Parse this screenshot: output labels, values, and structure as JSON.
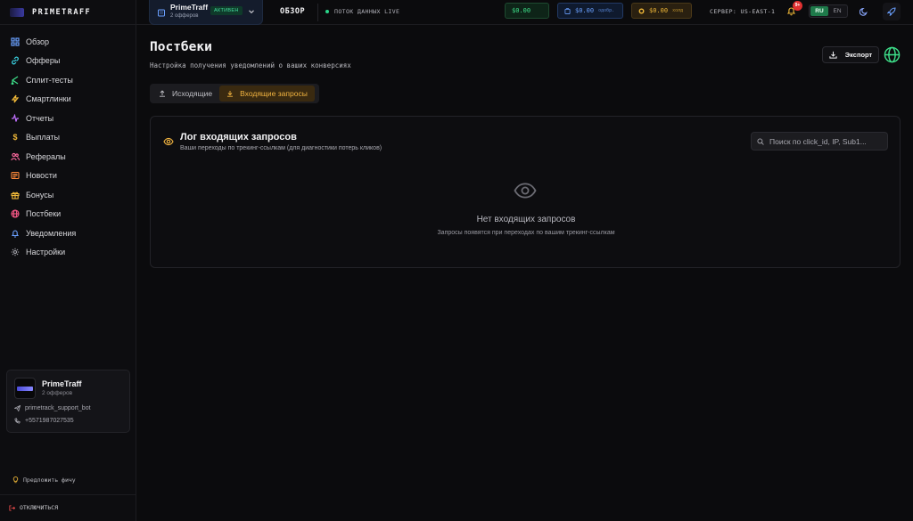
{
  "brand": {
    "name": "PRIMETRAFF"
  },
  "sidebar": {
    "items": [
      {
        "label": "Обзор",
        "icon": "grid-icon",
        "color": "#6aa0ff"
      },
      {
        "label": "Офферы",
        "icon": "link-icon",
        "color": "#3ad0e0"
      },
      {
        "label": "Сплит-тесты",
        "icon": "split-icon",
        "color": "#3ee08a"
      },
      {
        "label": "Смартлинки",
        "icon": "bolt-icon",
        "color": "#f0b838"
      },
      {
        "label": "Отчеты",
        "icon": "activity-icon",
        "color": "#c070ff"
      },
      {
        "label": "Выплаты",
        "icon": "dollar-icon",
        "color": "#f0b838"
      },
      {
        "label": "Рефералы",
        "icon": "users-icon",
        "color": "#ff6aa0"
      },
      {
        "label": "Новости",
        "icon": "newspaper-icon",
        "color": "#ff8a3a"
      },
      {
        "label": "Бонусы",
        "icon": "gift-icon",
        "color": "#f0b838"
      },
      {
        "label": "Постбеки",
        "icon": "globe-icon",
        "color": "#ff5a8a"
      },
      {
        "label": "Уведомления",
        "icon": "bell-icon",
        "color": "#6aa0ff"
      },
      {
        "label": "Настройки",
        "icon": "gear-icon",
        "color": "#a0a0a8"
      }
    ],
    "card": {
      "title": "PrimeTraff",
      "subtitle": "2 офферов",
      "telegram": "primetrack_support_bot",
      "phone": "+5571987027535"
    },
    "suggest_label": "Предложить фичу",
    "disconnect_label": "ОТКЛЮЧИТЬСЯ"
  },
  "topbar": {
    "switcher": {
      "name": "PrimeTraff",
      "subtitle": "2 офферов",
      "badge": "АКТИВЕН"
    },
    "overview_label": "ОБЗОР",
    "live_label": "ПОТОК ДАННЫХ LIVE",
    "balance_green": "$0.00",
    "balance_blue": "$0.00",
    "balance_blue_note": "одобр.",
    "balance_gold": "$0.00",
    "balance_gold_note": "холд",
    "server_label": "СЕРВЕР: US-EAST-1",
    "notif_count": "9+",
    "lang": {
      "ru": "RU",
      "en": "EN",
      "active": "RU"
    }
  },
  "page": {
    "title": "Постбеки",
    "subtitle": "Настройка получения уведомлений о ваших конверсиях",
    "export_label": "Экспорт",
    "tabs": {
      "outgoing": "Исходящие",
      "incoming": "Входящие запросы",
      "active": "incoming"
    },
    "panel": {
      "title": "Лог входящих запросов",
      "subtitle": "Ваши переходы по трекинг-ссылкам (для диагностики потерь кликов)",
      "search_placeholder": "Поиск по click_id, IP, Sub1...",
      "search_value": "",
      "empty_title": "Нет входящих запросов",
      "empty_subtitle": "Запросы появятся при переходах по вашим трекинг-ссылкам"
    }
  },
  "colors": {
    "accent_gold": "#f2b440",
    "accent_green": "#3ee08a",
    "accent_blue": "#6aa0ff"
  }
}
